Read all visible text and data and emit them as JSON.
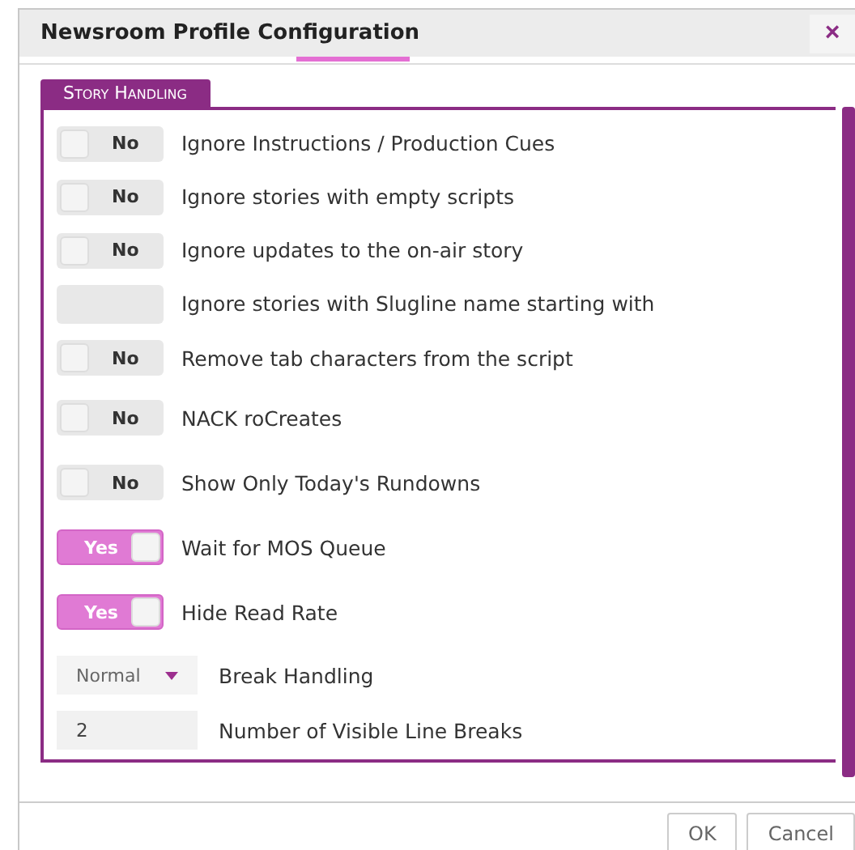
{
  "window": {
    "title": "Newsroom Profile Configuration",
    "close": "×"
  },
  "section": {
    "title": "Story Handling"
  },
  "rows": [
    {
      "kind": "toggle",
      "on": false,
      "state_text": "No",
      "label": "Ignore Instructions / Production Cues"
    },
    {
      "kind": "toggle",
      "on": false,
      "state_text": "No",
      "label": "Ignore stories with empty scripts"
    },
    {
      "kind": "toggle",
      "on": false,
      "state_text": "No",
      "label": "Ignore updates to the on-air story"
    },
    {
      "kind": "field",
      "label": "Ignore stories with Slugline name starting with"
    },
    {
      "kind": "toggle",
      "on": false,
      "state_text": "No",
      "label": "Remove tab characters from the script"
    },
    {
      "kind": "toggle",
      "on": false,
      "state_text": "No",
      "label": "NACK roCreates"
    },
    {
      "kind": "toggle",
      "on": false,
      "state_text": "No",
      "label": "Show Only Today's Rundowns"
    },
    {
      "kind": "toggle",
      "on": true,
      "state_text": "Yes",
      "label": "Wait for MOS Queue"
    },
    {
      "kind": "toggle",
      "on": true,
      "state_text": "Yes",
      "label": "Hide Read Rate"
    },
    {
      "kind": "select",
      "value": "Normal",
      "label": "Break Handling"
    },
    {
      "kind": "field",
      "value": "2",
      "label": "Number of Visible Line Breaks"
    }
  ],
  "buttons": [
    "OK",
    "Cancel"
  ]
}
